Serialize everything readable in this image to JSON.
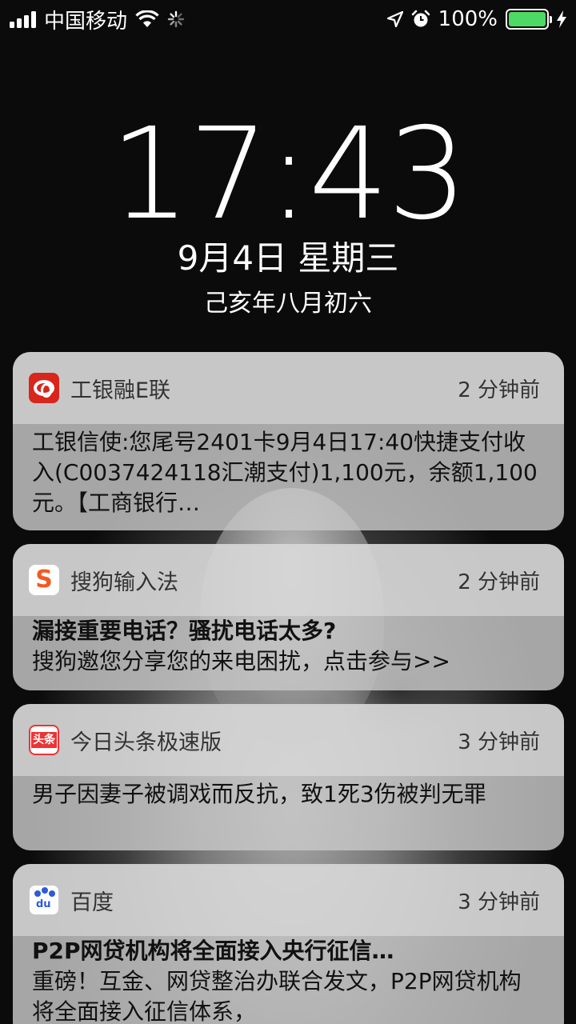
{
  "status_bar": {
    "carrier": "中国移动",
    "battery_percent": "100%",
    "battery_level": 1.0,
    "battery_color": "#4cd964",
    "icons": [
      "signal-icon",
      "wifi-icon",
      "activity-spinner-icon",
      "location-arrow-icon",
      "alarm-icon",
      "battery-icon",
      "charging-bolt-icon"
    ]
  },
  "lockscreen": {
    "time": "17:43",
    "date": "9月4日 星期三",
    "lunar_date": "己亥年八月初六"
  },
  "notifications": [
    {
      "app": "工银融E联",
      "icon": "icbc-app-icon",
      "time_ago": "2 分钟前",
      "title": "",
      "body": "工银信使:您尾号2401卡9月4日17:40快捷支付收入(C0037424118汇潮支付)1,100元，余额1,100元。【工商银行…"
    },
    {
      "app": "搜狗输入法",
      "icon": "sogou-app-icon",
      "time_ago": "2 分钟前",
      "title": "漏接重要电话？骚扰电话太多?",
      "body": "搜狗邀您分享您的来电困扰，点击参与>>"
    },
    {
      "app": "今日头条极速版",
      "icon": "toutiao-app-icon",
      "icon_text": "头条",
      "time_ago": "3 分钟前",
      "title": "",
      "body": "男子因妻子被调戏而反抗，致1死3伤被判无罪"
    },
    {
      "app": "百度",
      "icon": "baidu-app-icon",
      "icon_text": "du",
      "time_ago": "3 分钟前",
      "title": "P2P网贷机构将全面接入央行征信…",
      "body": "重磅！互金、网贷整治办联合发文，P2P网贷机构将全面接入征信体系，"
    }
  ]
}
